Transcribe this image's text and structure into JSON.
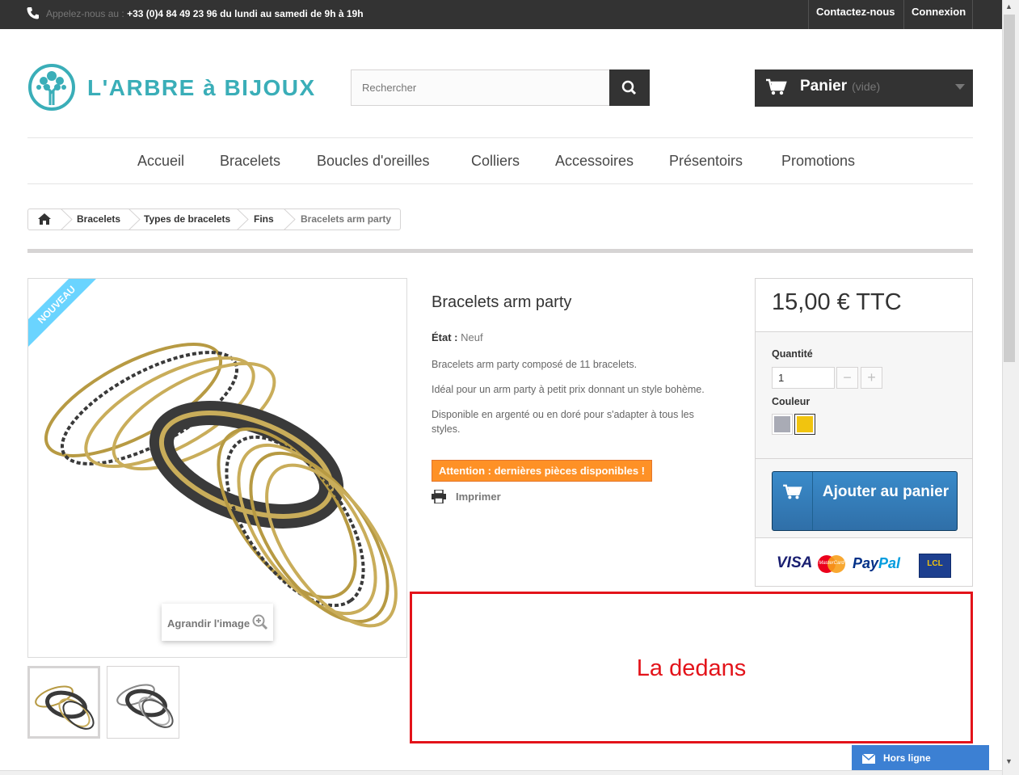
{
  "topbar": {
    "call_prefix": "Appelez-nous au :",
    "call_text": "+33 (0)4 84 49 23 96 du lundi au samedi de 9h à 19h",
    "contact_label": "Contactez-nous",
    "login_label": "Connexion"
  },
  "logo": {
    "text": "L'ARBRE à BIJOUX",
    "color": "#3aaeb8"
  },
  "search": {
    "placeholder": "Rechercher"
  },
  "cart": {
    "label": "Panier",
    "status": "(vide)"
  },
  "menu": {
    "items": [
      "Accueil",
      "Bracelets",
      "Boucles d'oreilles",
      "Colliers",
      "Accessoires",
      "Présentoirs",
      "Promotions"
    ]
  },
  "breadcrumb": {
    "items": [
      "Bracelets",
      "Types de bracelets",
      "Fins",
      "Bracelets arm party"
    ]
  },
  "product": {
    "badge": "Nouveau",
    "zoom_label": "Agrandir l'image",
    "title": "Bracelets arm party",
    "condition_label": "État :",
    "condition_value": "Neuf",
    "description": [
      "Bracelets arm party composé de 11 bracelets.",
      "Idéal pour un arm party à petit prix donnant un style bohème.",
      "Disponible en argenté ou en doré pour s'adapter à tous les styles."
    ],
    "warning": "Attention : dernières pièces disponibles !",
    "print_label": "Imprimer"
  },
  "buy": {
    "price": "15,00 € TTC",
    "quantity_label": "Quantité",
    "quantity_value": "1",
    "color_label": "Couleur",
    "colors": [
      "#a9abb5",
      "#f1c40f"
    ],
    "add_to_cart": "Ajouter au panier",
    "payment": {
      "visa": "VISA",
      "mastercard": "MasterCard",
      "paypal_pay": "Pay",
      "paypal_pal": "Pal",
      "lcl": "LCL"
    }
  },
  "annotation": {
    "text": "La dedans",
    "color": "#e3131a"
  },
  "chat": {
    "label": "Hors ligne"
  }
}
